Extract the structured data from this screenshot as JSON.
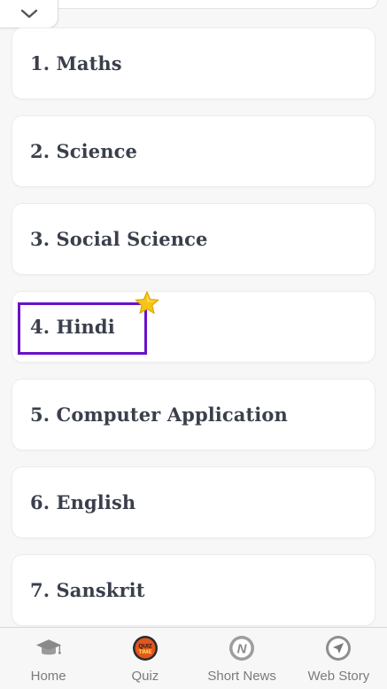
{
  "subjects": [
    {
      "label": "1. Maths"
    },
    {
      "label": "2. Science"
    },
    {
      "label": "3. Social Science"
    },
    {
      "label": "4. Hindi"
    },
    {
      "label": "5. Computer Application"
    },
    {
      "label": "6. English"
    },
    {
      "label": "7. Sanskrit"
    }
  ],
  "nav": {
    "home": "Home",
    "quiz": "Quiz",
    "quiz_icon_text": "QUIZ TIME",
    "short_news": "Short News",
    "short_news_icon_text": "N",
    "web_story": "Web Story"
  },
  "colors": {
    "highlight": "#6a12c9",
    "text": "#3a3f4b",
    "nav_text": "#7b7b7b",
    "star": "#f5c518"
  },
  "icons": {
    "collapse": "chevron-down-icon",
    "highlight_badge": "star-icon",
    "home": "graduation-cap-icon",
    "quiz": "quiz-time-icon",
    "short_news": "news-icon",
    "web_story": "paper-plane-icon"
  }
}
